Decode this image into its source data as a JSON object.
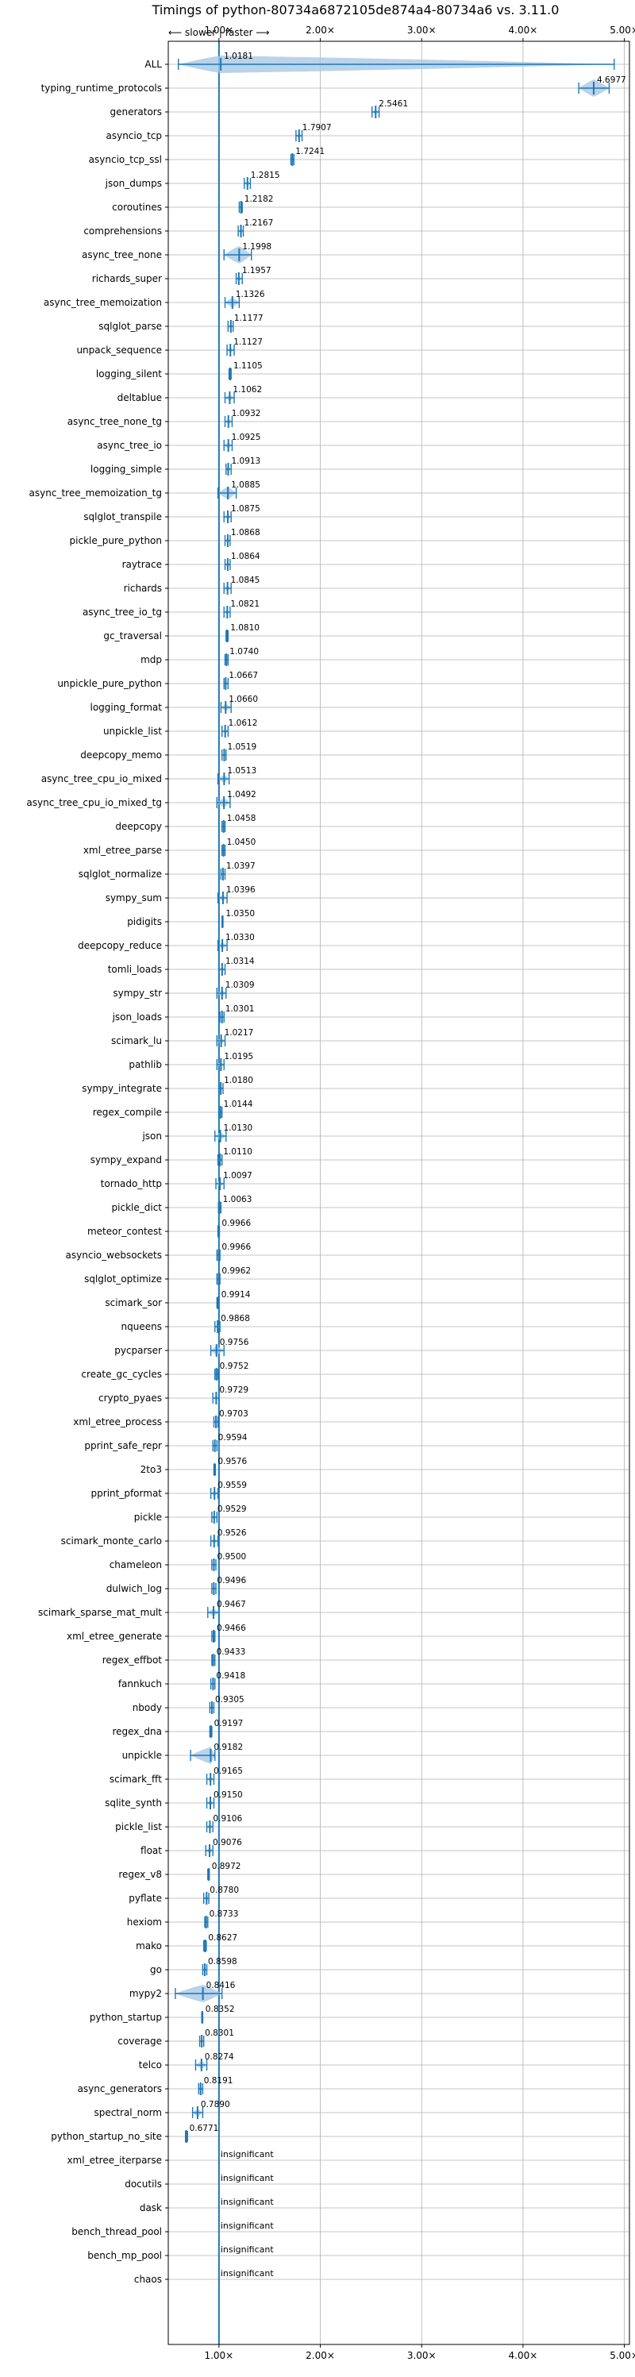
{
  "chart_data": {
    "type": "violin",
    "title": "Timings of python-80734a6872105de874a4-80734a6 vs. 3.11.0",
    "direction_hint": "⟵ slower | faster ⟶",
    "xlim": [
      0.5,
      5.05
    ],
    "x_ticks": [
      1,
      2,
      3,
      4,
      5
    ],
    "x_tick_labels": [
      "1.00×",
      "2.00×",
      "3.00×",
      "4.00×",
      "5.00×"
    ],
    "grid": true,
    "reference_line": 1.0,
    "insignificant_label": "insignificant",
    "colors": {
      "line": "#1f77b4",
      "violin": "#a6c8e5",
      "grid": "#b0b0b0",
      "median_marker": "#ff9999"
    },
    "benchmarks": [
      {
        "name": "ALL",
        "value": 1.0181,
        "label": "1.0181",
        "min": 0.6,
        "max": 4.9
      },
      {
        "name": "typing_runtime_protocols",
        "value": 4.6977,
        "label": "4.6977",
        "min": 4.55,
        "max": 4.85
      },
      {
        "name": "generators",
        "value": 2.5461,
        "label": "2.5461",
        "min": 2.51,
        "max": 2.58
      },
      {
        "name": "asyncio_tcp",
        "value": 1.7907,
        "label": "1.7907",
        "min": 1.76,
        "max": 1.82
      },
      {
        "name": "asyncio_tcp_ssl",
        "value": 1.7241,
        "label": "1.7241",
        "min": 1.71,
        "max": 1.74
      },
      {
        "name": "json_dumps",
        "value": 1.2815,
        "label": "1.2815",
        "min": 1.25,
        "max": 1.31
      },
      {
        "name": "coroutines",
        "value": 1.2182,
        "label": "1.2182",
        "min": 1.2,
        "max": 1.23
      },
      {
        "name": "comprehensions",
        "value": 1.2167,
        "label": "1.2167",
        "min": 1.19,
        "max": 1.24
      },
      {
        "name": "async_tree_none",
        "value": 1.1998,
        "label": "1.1998",
        "min": 1.05,
        "max": 1.32
      },
      {
        "name": "richards_super",
        "value": 1.1957,
        "label": "1.1957",
        "min": 1.17,
        "max": 1.23
      },
      {
        "name": "async_tree_memoization",
        "value": 1.1326,
        "label": "1.1326",
        "min": 1.06,
        "max": 1.2
      },
      {
        "name": "sqlglot_parse",
        "value": 1.1177,
        "label": "1.1177",
        "min": 1.09,
        "max": 1.14
      },
      {
        "name": "unpack_sequence",
        "value": 1.1127,
        "label": "1.1127",
        "min": 1.08,
        "max": 1.15
      },
      {
        "name": "logging_silent",
        "value": 1.1105,
        "label": "1.1105",
        "min": 1.1,
        "max": 1.12
      },
      {
        "name": "deltablue",
        "value": 1.1062,
        "label": "1.1062",
        "min": 1.06,
        "max": 1.15
      },
      {
        "name": "async_tree_none_tg",
        "value": 1.0932,
        "label": "1.0932",
        "min": 1.06,
        "max": 1.13
      },
      {
        "name": "async_tree_io",
        "value": 1.0925,
        "label": "1.0925",
        "min": 1.05,
        "max": 1.13
      },
      {
        "name": "logging_simple",
        "value": 1.0913,
        "label": "1.0913",
        "min": 1.07,
        "max": 1.12
      },
      {
        "name": "async_tree_memoization_tg",
        "value": 1.0885,
        "label": "1.0885",
        "min": 0.99,
        "max": 1.17
      },
      {
        "name": "sqlglot_transpile",
        "value": 1.0875,
        "label": "1.0875",
        "min": 1.05,
        "max": 1.12
      },
      {
        "name": "pickle_pure_python",
        "value": 1.0868,
        "label": "1.0868",
        "min": 1.06,
        "max": 1.11
      },
      {
        "name": "raytrace",
        "value": 1.0864,
        "label": "1.0864",
        "min": 1.06,
        "max": 1.11
      },
      {
        "name": "richards",
        "value": 1.0845,
        "label": "1.0845",
        "min": 1.05,
        "max": 1.12
      },
      {
        "name": "async_tree_io_tg",
        "value": 1.0821,
        "label": "1.0821",
        "min": 1.05,
        "max": 1.11
      },
      {
        "name": "gc_traversal",
        "value": 1.081,
        "label": "1.0810",
        "min": 1.07,
        "max": 1.09
      },
      {
        "name": "mdp",
        "value": 1.074,
        "label": "1.0740",
        "min": 1.06,
        "max": 1.09
      },
      {
        "name": "unpickle_pure_python",
        "value": 1.0667,
        "label": "1.0667",
        "min": 1.05,
        "max": 1.09
      },
      {
        "name": "logging_format",
        "value": 1.066,
        "label": "1.0660",
        "min": 1.02,
        "max": 1.12
      },
      {
        "name": "unpickle_list",
        "value": 1.0612,
        "label": "1.0612",
        "min": 1.03,
        "max": 1.09
      },
      {
        "name": "deepcopy_memo",
        "value": 1.0519,
        "label": "1.0519",
        "min": 1.03,
        "max": 1.07
      },
      {
        "name": "async_tree_cpu_io_mixed",
        "value": 1.0513,
        "label": "1.0513",
        "min": 0.99,
        "max": 1.1
      },
      {
        "name": "async_tree_cpu_io_mixed_tg",
        "value": 1.0492,
        "label": "1.0492",
        "min": 0.98,
        "max": 1.11
      },
      {
        "name": "deepcopy",
        "value": 1.0458,
        "label": "1.0458",
        "min": 1.03,
        "max": 1.06
      },
      {
        "name": "xml_etree_parse",
        "value": 1.045,
        "label": "1.0450",
        "min": 1.03,
        "max": 1.06
      },
      {
        "name": "sqlglot_normalize",
        "value": 1.0397,
        "label": "1.0397",
        "min": 1.02,
        "max": 1.06
      },
      {
        "name": "sympy_sum",
        "value": 1.0396,
        "label": "1.0396",
        "min": 0.99,
        "max": 1.08
      },
      {
        "name": "pidigits",
        "value": 1.035,
        "label": "1.0350",
        "min": 1.03,
        "max": 1.04
      },
      {
        "name": "deepcopy_reduce",
        "value": 1.033,
        "label": "1.0330",
        "min": 0.99,
        "max": 1.08
      },
      {
        "name": "tomli_loads",
        "value": 1.0314,
        "label": "1.0314",
        "min": 1.0,
        "max": 1.06
      },
      {
        "name": "sympy_str",
        "value": 1.0309,
        "label": "1.0309",
        "min": 0.98,
        "max": 1.07
      },
      {
        "name": "json_loads",
        "value": 1.0301,
        "label": "1.0301",
        "min": 1.01,
        "max": 1.05
      },
      {
        "name": "scimark_lu",
        "value": 1.0217,
        "label": "1.0217",
        "min": 0.98,
        "max": 1.06
      },
      {
        "name": "pathlib",
        "value": 1.0195,
        "label": "1.0195",
        "min": 0.98,
        "max": 1.05
      },
      {
        "name": "sympy_integrate",
        "value": 1.018,
        "label": "1.0180",
        "min": 1.0,
        "max": 1.04
      },
      {
        "name": "regex_compile",
        "value": 1.0144,
        "label": "1.0144",
        "min": 1.0,
        "max": 1.03
      },
      {
        "name": "json",
        "value": 1.013,
        "label": "1.0130",
        "min": 0.96,
        "max": 1.07
      },
      {
        "name": "sympy_expand",
        "value": 1.011,
        "label": "1.0110",
        "min": 0.99,
        "max": 1.03
      },
      {
        "name": "tornado_http",
        "value": 1.0097,
        "label": "1.0097",
        "min": 0.97,
        "max": 1.05
      },
      {
        "name": "pickle_dict",
        "value": 1.0063,
        "label": "1.0063",
        "min": 0.995,
        "max": 1.02
      },
      {
        "name": "meteor_contest",
        "value": 0.9966,
        "label": "0.9966",
        "min": 0.99,
        "max": 1.005
      },
      {
        "name": "asyncio_websockets",
        "value": 0.9966,
        "label": "0.9966",
        "min": 0.98,
        "max": 1.01
      },
      {
        "name": "sqlglot_optimize",
        "value": 0.9962,
        "label": "0.9962",
        "min": 0.98,
        "max": 1.01
      },
      {
        "name": "scimark_sor",
        "value": 0.9914,
        "label": "0.9914",
        "min": 0.98,
        "max": 1.0
      },
      {
        "name": "nqueens",
        "value": 0.9868,
        "label": "0.9868",
        "min": 0.96,
        "max": 1.01
      },
      {
        "name": "pycparser",
        "value": 0.9756,
        "label": "0.9756",
        "min": 0.92,
        "max": 1.05
      },
      {
        "name": "create_gc_cycles",
        "value": 0.9752,
        "label": "0.9752",
        "min": 0.96,
        "max": 0.99
      },
      {
        "name": "crypto_pyaes",
        "value": 0.9729,
        "label": "0.9729",
        "min": 0.94,
        "max": 1.0
      },
      {
        "name": "xml_etree_process",
        "value": 0.9703,
        "label": "0.9703",
        "min": 0.95,
        "max": 0.99
      },
      {
        "name": "pprint_safe_repr",
        "value": 0.9594,
        "label": "0.9594",
        "min": 0.94,
        "max": 0.98
      },
      {
        "name": "2to3",
        "value": 0.9576,
        "label": "0.9576",
        "min": 0.95,
        "max": 0.965
      },
      {
        "name": "pprint_pformat",
        "value": 0.9559,
        "label": "0.9559",
        "min": 0.92,
        "max": 0.99
      },
      {
        "name": "pickle",
        "value": 0.9529,
        "label": "0.9529",
        "min": 0.93,
        "max": 0.98
      },
      {
        "name": "scimark_monte_carlo",
        "value": 0.9526,
        "label": "0.9526",
        "min": 0.92,
        "max": 0.99
      },
      {
        "name": "chameleon",
        "value": 0.95,
        "label": "0.9500",
        "min": 0.93,
        "max": 0.97
      },
      {
        "name": "dulwich_log",
        "value": 0.9496,
        "label": "0.9496",
        "min": 0.93,
        "max": 0.97
      },
      {
        "name": "scimark_sparse_mat_mult",
        "value": 0.9467,
        "label": "0.9467",
        "min": 0.89,
        "max": 1.0
      },
      {
        "name": "xml_etree_generate",
        "value": 0.9466,
        "label": "0.9466",
        "min": 0.93,
        "max": 0.96
      },
      {
        "name": "regex_effbot",
        "value": 0.9433,
        "label": "0.9433",
        "min": 0.93,
        "max": 0.96
      },
      {
        "name": "fannkuch",
        "value": 0.9418,
        "label": "0.9418",
        "min": 0.92,
        "max": 0.96
      },
      {
        "name": "nbody",
        "value": 0.9305,
        "label": "0.9305",
        "min": 0.91,
        "max": 0.95
      },
      {
        "name": "regex_dna",
        "value": 0.9197,
        "label": "0.9197",
        "min": 0.91,
        "max": 0.93
      },
      {
        "name": "unpickle",
        "value": 0.9182,
        "label": "0.9182",
        "min": 0.72,
        "max": 0.96
      },
      {
        "name": "scimark_fft",
        "value": 0.9165,
        "label": "0.9165",
        "min": 0.88,
        "max": 0.95
      },
      {
        "name": "sqlite_synth",
        "value": 0.915,
        "label": "0.9150",
        "min": 0.88,
        "max": 0.95
      },
      {
        "name": "pickle_list",
        "value": 0.9106,
        "label": "0.9106",
        "min": 0.88,
        "max": 0.94
      },
      {
        "name": "float",
        "value": 0.9076,
        "label": "0.9076",
        "min": 0.87,
        "max": 0.94
      },
      {
        "name": "regex_v8",
        "value": 0.8972,
        "label": "0.8972",
        "min": 0.89,
        "max": 0.905
      },
      {
        "name": "pyflate",
        "value": 0.878,
        "label": "0.8780",
        "min": 0.85,
        "max": 0.9
      },
      {
        "name": "hexiom",
        "value": 0.8733,
        "label": "0.8733",
        "min": 0.86,
        "max": 0.89
      },
      {
        "name": "mako",
        "value": 0.8627,
        "label": "0.8627",
        "min": 0.85,
        "max": 0.875
      },
      {
        "name": "go",
        "value": 0.8598,
        "label": "0.8598",
        "min": 0.84,
        "max": 0.88
      },
      {
        "name": "mypy2",
        "value": 0.8416,
        "label": "0.8416",
        "min": 0.57,
        "max": 1.03
      },
      {
        "name": "python_startup",
        "value": 0.8352,
        "label": "0.8352",
        "min": 0.83,
        "max": 0.84
      },
      {
        "name": "coverage",
        "value": 0.8301,
        "label": "0.8301",
        "min": 0.81,
        "max": 0.85
      },
      {
        "name": "telco",
        "value": 0.8274,
        "label": "0.8274",
        "min": 0.77,
        "max": 0.88
      },
      {
        "name": "async_generators",
        "value": 0.8191,
        "label": "0.8191",
        "min": 0.8,
        "max": 0.84
      },
      {
        "name": "spectral_norm",
        "value": 0.789,
        "label": "0.7890",
        "min": 0.74,
        "max": 0.84
      },
      {
        "name": "python_startup_no_site",
        "value": 0.6771,
        "label": "0.6771",
        "min": 0.67,
        "max": 0.69
      },
      {
        "name": "xml_etree_iterparse",
        "value": 1.0,
        "label": "insignificant",
        "insignificant": true
      },
      {
        "name": "docutils",
        "value": 1.0,
        "label": "insignificant",
        "insignificant": true
      },
      {
        "name": "dask",
        "value": 1.0,
        "label": "insignificant",
        "insignificant": true
      },
      {
        "name": "bench_thread_pool",
        "value": 1.0,
        "label": "insignificant",
        "insignificant": true
      },
      {
        "name": "bench_mp_pool",
        "value": 1.0,
        "label": "insignificant",
        "insignificant": true
      },
      {
        "name": "chaos",
        "value": 1.0,
        "label": "insignificant",
        "insignificant": true
      }
    ]
  }
}
